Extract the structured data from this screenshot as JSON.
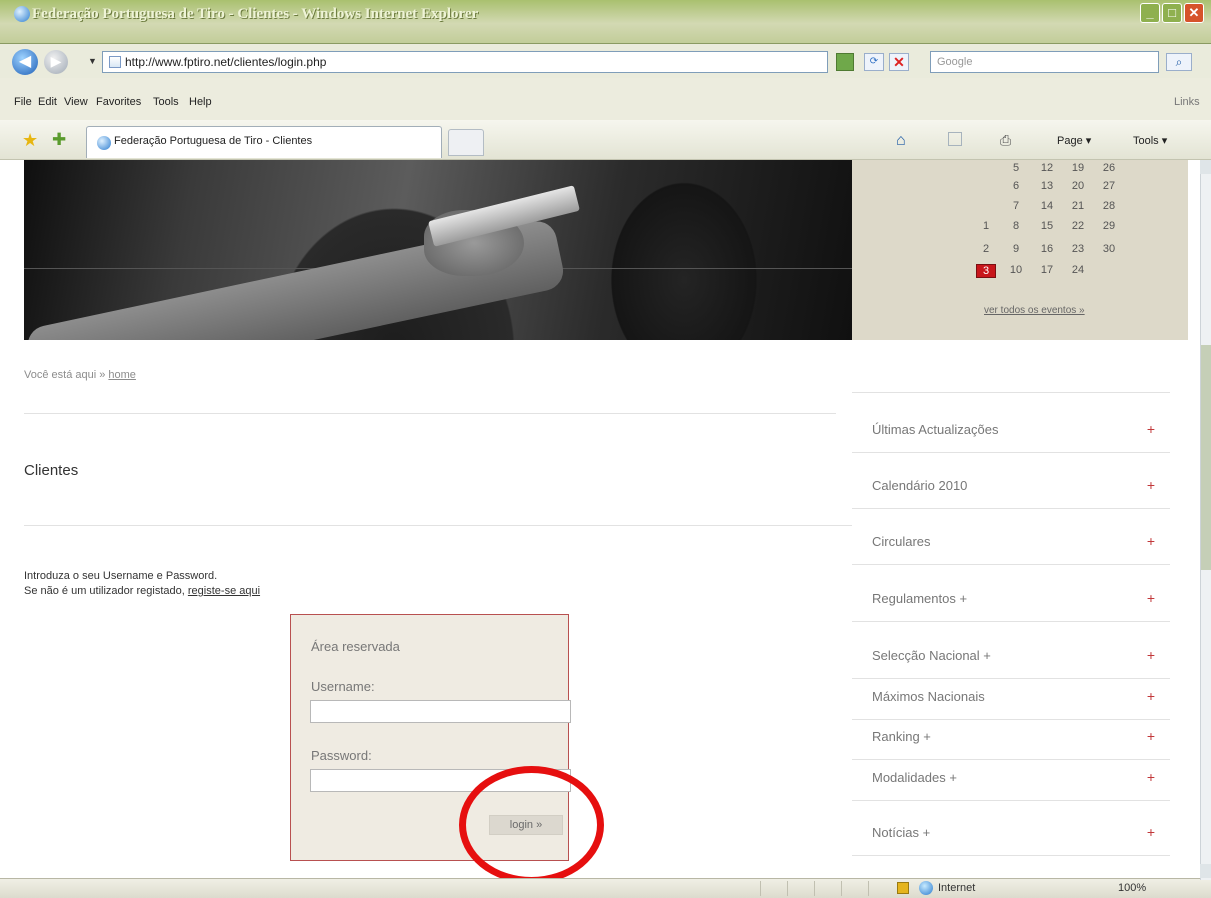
{
  "browser": {
    "title": "Federação Portuguesa de Tiro - Clientes - Windows Internet Explorer",
    "address": "http://www.fptiro.net/clientes/login.php",
    "search_placeholder": "Google",
    "menu": [
      "File",
      "Edit",
      "View",
      "Favorites",
      "Tools",
      "Help"
    ],
    "links_label": "Links",
    "tab_title": "Federação Portuguesa de Tiro - Clientes",
    "commands": {
      "page": "Page ▾",
      "tools": "Tools ▾"
    },
    "status": {
      "zone": "Internet",
      "zoom": "100%"
    }
  },
  "calendar": {
    "weeks": [
      [
        "",
        "5",
        "12",
        "19",
        "26"
      ],
      [
        "",
        "6",
        "13",
        "20",
        "27"
      ],
      [
        "",
        "7",
        "14",
        "21",
        "28"
      ],
      [
        "1",
        "8",
        "15",
        "22",
        "29"
      ],
      [
        "2",
        "9",
        "16",
        "23",
        "30"
      ],
      [
        "3",
        "10",
        "17",
        "24",
        ""
      ]
    ],
    "today": "3",
    "link": "ver todos os eventos »"
  },
  "breadcrumb": {
    "prefix": "Você está aqui »",
    "link": "home"
  },
  "page": {
    "title": "Clientes",
    "intro_line1": "Introduza o seu Username e Password.",
    "intro_line2_prefix": "Se não é um utilizador registado,",
    "intro_link": "registe-se aqui"
  },
  "login": {
    "title": "Área reservada",
    "username_label": "Username:",
    "username_value": "",
    "password_label": "Password:",
    "password_value": "",
    "button_label": "login »"
  },
  "sidebar": {
    "items": [
      {
        "label": "Últimas Actualizações",
        "expander": "+"
      },
      {
        "label": "Calendário 2010",
        "expander": "+"
      },
      {
        "label": "Circulares",
        "expander": "+"
      },
      {
        "label": "Regulamentos +",
        "expander": "+"
      },
      {
        "label": "Selecção Nacional +",
        "expander": "+"
      },
      {
        "label": "Máximos Nacionais",
        "expander": "+"
      },
      {
        "label": "Ranking +",
        "expander": "+"
      },
      {
        "label": "Modalidades +",
        "expander": "+"
      },
      {
        "label": "Notícias +",
        "expander": "+"
      }
    ]
  },
  "colors": {
    "accent_red": "#e60f0f",
    "link_plus": "#c2383a",
    "sidebar_bg": "#ddd9c9",
    "login_border": "#b85050"
  }
}
